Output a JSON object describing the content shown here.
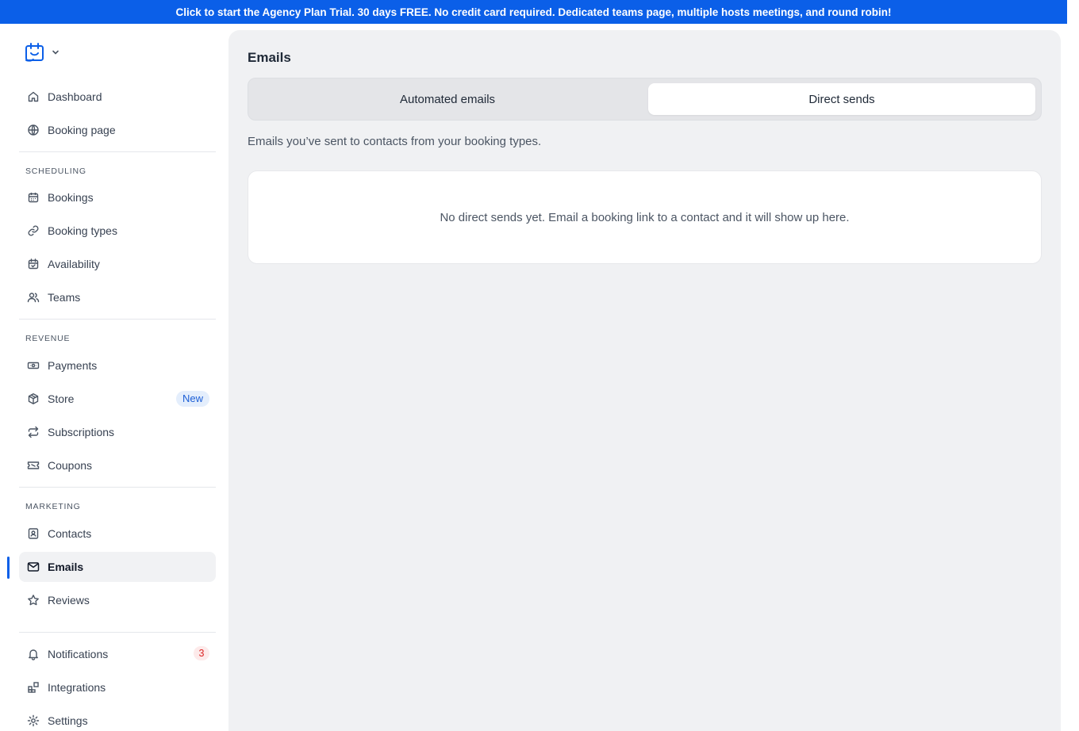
{
  "banner": {
    "text": "Click to start the Agency Plan Trial. 30 days FREE. No credit card required. Dedicated teams page, multiple hosts meetings, and round robin!"
  },
  "sidebar": {
    "logo_icon": "calendar-logo-icon",
    "top_items": [
      {
        "label": "Dashboard",
        "icon": "home-icon"
      },
      {
        "label": "Booking page",
        "icon": "globe-icon"
      }
    ],
    "sections": [
      {
        "label": "SCHEDULING",
        "items": [
          {
            "label": "Bookings",
            "icon": "calendar-icon"
          },
          {
            "label": "Booking types",
            "icon": "link-icon"
          },
          {
            "label": "Availability",
            "icon": "calendar-check-icon"
          },
          {
            "label": "Teams",
            "icon": "users-icon"
          }
        ]
      },
      {
        "label": "REVENUE",
        "items": [
          {
            "label": "Payments",
            "icon": "banknote-icon"
          },
          {
            "label": "Store",
            "icon": "box-icon",
            "badge": "New"
          },
          {
            "label": "Subscriptions",
            "icon": "repeat-icon"
          },
          {
            "label": "Coupons",
            "icon": "ticket-icon"
          }
        ]
      },
      {
        "label": "MARKETING",
        "items": [
          {
            "label": "Contacts",
            "icon": "contact-icon"
          },
          {
            "label": "Emails",
            "icon": "mail-icon",
            "active": true
          },
          {
            "label": "Reviews",
            "icon": "star-icon"
          }
        ]
      }
    ],
    "bottom_items": [
      {
        "label": "Notifications",
        "icon": "bell-icon",
        "badge": "3"
      },
      {
        "label": "Integrations",
        "icon": "blocks-icon"
      },
      {
        "label": "Settings",
        "icon": "gear-icon"
      }
    ]
  },
  "main": {
    "title": "Emails",
    "tabs": [
      {
        "label": "Automated emails",
        "selected": false
      },
      {
        "label": "Direct sends",
        "selected": true
      }
    ],
    "description": "Emails you’ve sent to contacts from your booking types.",
    "empty_state": "No direct sends yet. Email a booking link to a contact and it will show up here."
  },
  "colors": {
    "accent": "#0b5fe8",
    "banner_bg": "#0b5fe8",
    "main_bg": "#f0f1f3",
    "badge_new_bg": "#e4eefc",
    "badge_count_fg": "#dc2626"
  }
}
